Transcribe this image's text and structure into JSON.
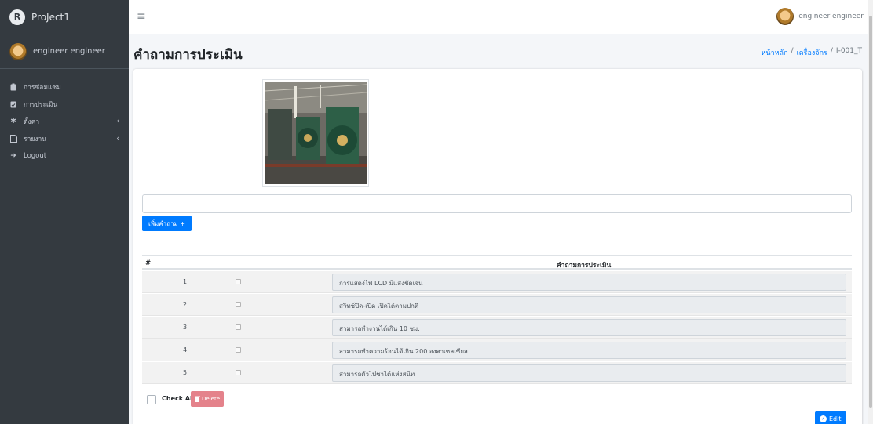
{
  "brand": {
    "logo_letter": "R",
    "title": "ProJect1"
  },
  "user": {
    "name": "engineer engineer"
  },
  "sidebar": {
    "items": [
      {
        "label": "การซ่อมแซม",
        "icon": "clipboard-icon",
        "has_caret": false
      },
      {
        "label": "การประเมิน",
        "icon": "clipboard-check-icon",
        "has_caret": false
      },
      {
        "label": "ตั้งค่า",
        "icon": "gear-icon",
        "has_caret": true
      },
      {
        "label": "รายงาน",
        "icon": "file-pdf-icon",
        "has_caret": true
      },
      {
        "label": "Logout",
        "icon": "sign-out-icon",
        "has_caret": false
      }
    ]
  },
  "topbar": {
    "menu_icon": "≡"
  },
  "header": {
    "title": "คำถามการประเมิน",
    "breadcrumb": [
      "หน้าหลัก",
      "/",
      "เครื่องจักร",
      "/",
      "I-001_T"
    ]
  },
  "form": {
    "question_value": "",
    "add_button": "เพิ่มคำถาม +"
  },
  "table": {
    "columns": [
      "#",
      "คำถามการประเมิน"
    ],
    "rows": [
      {
        "num": "1",
        "question": "การแสดงไฟ LCD มีแสงชัดเจน"
      },
      {
        "num": "2",
        "question": "สวิทช์ปิด-เปิด เปิดได้ตามปกติ"
      },
      {
        "num": "3",
        "question": "สามารถทำงานได้เกิน 10 ชม."
      },
      {
        "num": "4",
        "question": "สามารถทำความร้อนได้เกิน 200 องศาเซลเซียส"
      },
      {
        "num": "5",
        "question": "สามารถตัวไปชาได้แห่งสนิท"
      }
    ]
  },
  "footer": {
    "check_all": "Check All",
    "delete": "Delete",
    "edit": "Edit"
  },
  "colors": {
    "sidebar": "#343a40",
    "primary": "#007bff",
    "danger_disabled": "#e4828b"
  }
}
